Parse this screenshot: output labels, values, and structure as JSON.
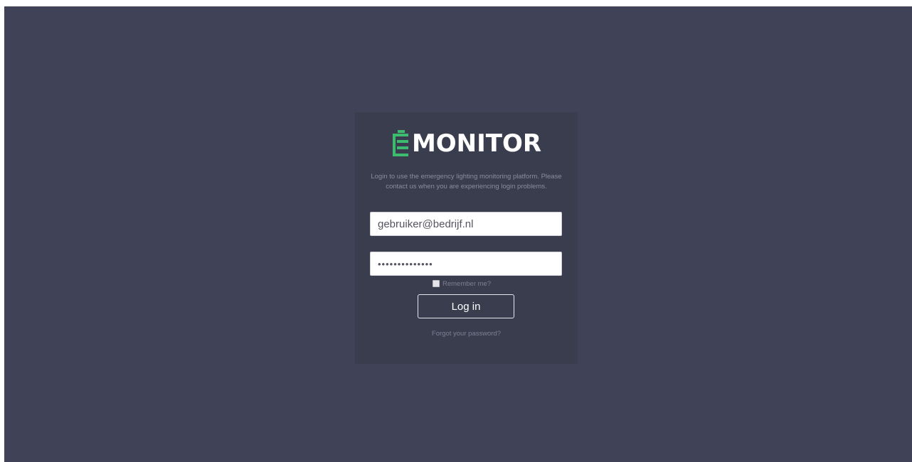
{
  "brand": {
    "name": "MONITOR",
    "logo_icon": "battery-emergency-icon",
    "accent_color": "#3dbb6e"
  },
  "login": {
    "intro_text": "Login to use the emergency lighting monitoring platform. Please contact us when you are experiencing login problems.",
    "email_value": "gebruiker@bedrijf.nl",
    "password_value": "••••••••••••••",
    "remember_label": "Remember me?",
    "remember_checked": false,
    "submit_label": "Log in",
    "forgot_label": "Forgot your password?"
  },
  "colors": {
    "page_background": "#404357",
    "card_background": "#3a3d4e"
  }
}
